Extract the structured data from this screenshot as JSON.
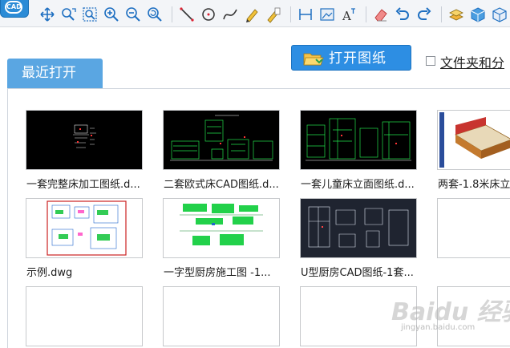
{
  "toolbar": {
    "tools": [
      {
        "icon": "pan-icon"
      },
      {
        "icon": "zoom-window-icon"
      },
      {
        "icon": "zoom-extents-icon"
      },
      {
        "icon": "zoom-in-icon"
      },
      {
        "icon": "zoom-out-icon"
      },
      {
        "icon": "zoom-previous-icon"
      },
      {
        "icon": "line-icon"
      },
      {
        "icon": "circle-icon"
      },
      {
        "icon": "spline-icon"
      },
      {
        "icon": "pencil-icon"
      },
      {
        "icon": "text-edit-icon"
      },
      {
        "icon": "measure-icon"
      },
      {
        "icon": "image-icon"
      },
      {
        "icon": "text-style-icon"
      },
      {
        "icon": "eraser-icon"
      },
      {
        "icon": "undo-icon"
      },
      {
        "icon": "redo-icon"
      },
      {
        "icon": "layer-icon"
      },
      {
        "icon": "3d-cube-icon"
      },
      {
        "icon": "3d-view-icon"
      }
    ]
  },
  "actions": {
    "open_drawing": "打开图纸",
    "folder_checkbox_label": "文件夹和分"
  },
  "tabs": {
    "recent": "最近打开"
  },
  "files": [
    {
      "name": "一套完整床加工图纸.d...",
      "preview": "dark-sparse"
    },
    {
      "name": "二套欧式床CAD图纸.d...",
      "preview": "dark-green"
    },
    {
      "name": "一套儿童床立面图纸.d...",
      "preview": "dark-green"
    },
    {
      "name": "两套-1.8米床立",
      "preview": "color-render"
    },
    {
      "name": "示例.dwg",
      "preview": "white-plan"
    },
    {
      "name": "一字型厨房施工图 -1...",
      "preview": "white-green"
    },
    {
      "name": "U型厨房CAD图纸-1套...",
      "preview": "navy-plan"
    },
    {
      "name": "",
      "preview": "empty"
    },
    {
      "name": "",
      "preview": "empty"
    },
    {
      "name": "",
      "preview": "empty"
    },
    {
      "name": "",
      "preview": "empty"
    },
    {
      "name": "",
      "preview": "empty"
    }
  ],
  "watermark": {
    "text": "Baidu 经验",
    "sub": "jingyan.baidu.com"
  },
  "colors": {
    "accent": "#2d8ee3",
    "tab": "#5aa6e2",
    "cad_green": "#22e04a",
    "cad_bg": "#000000"
  }
}
